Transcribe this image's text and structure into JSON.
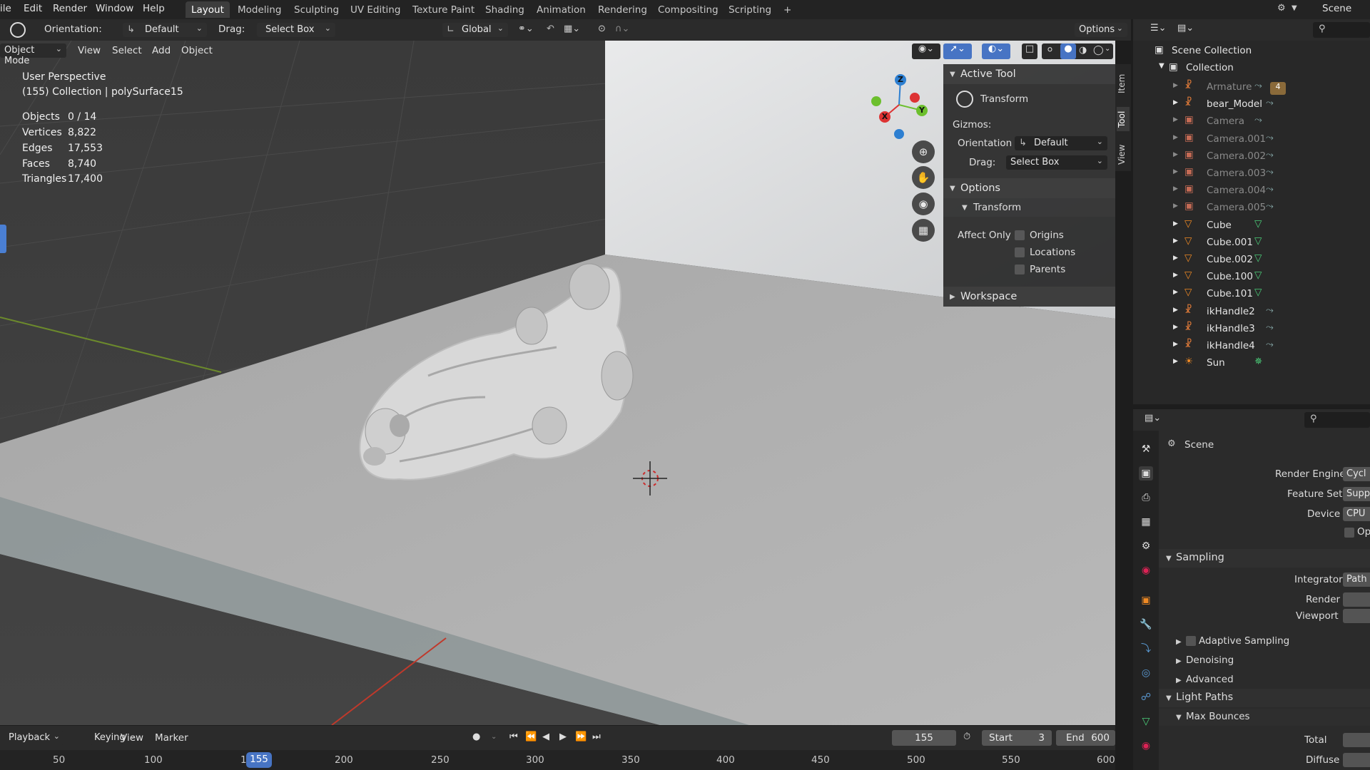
{
  "menubar": {
    "items": [
      "ile",
      "Edit",
      "Render",
      "Window",
      "Help"
    ],
    "tabs": [
      "Layout",
      "Modeling",
      "Sculpting",
      "UV Editing",
      "Texture Paint",
      "Shading",
      "Animation",
      "Rendering",
      "Compositing",
      "Scripting"
    ],
    "add_tab": "+",
    "scene_label": "Scene"
  },
  "tool_header": {
    "orientation_label": "Orientation:",
    "orientation_value": "Default",
    "drag_label": "Drag:",
    "drag_value": "Select Box",
    "transform_orientation": "Global",
    "options_label": "Options"
  },
  "viewport_header": {
    "mode": "Object Mode",
    "menus": [
      "View",
      "Select",
      "Add",
      "Object"
    ]
  },
  "overlay": {
    "perspective": "User Perspective",
    "context": "(155) Collection | polySurface15",
    "stats": [
      {
        "label": "Objects",
        "value": "0 / 14"
      },
      {
        "label": "Vertices",
        "value": "8,822"
      },
      {
        "label": "Edges",
        "value": "17,553"
      },
      {
        "label": "Faces",
        "value": "8,740"
      },
      {
        "label": "Triangles",
        "value": "17,400"
      }
    ]
  },
  "gizmo": {
    "x": "X",
    "y": "Y",
    "z": "Z"
  },
  "npanel": {
    "active_tool_title": "Active Tool",
    "tool_name": "Transform",
    "gizmos_label": "Gizmos:",
    "orientation_label": "Orientation",
    "orientation_value": "Default",
    "drag_label": "Drag:",
    "drag_value": "Select Box",
    "options_title": "Options",
    "transform_sub": "Transform",
    "affect_only_label": "Affect Only",
    "affect_items": [
      "Origins",
      "Locations",
      "Parents"
    ],
    "workspace_title": "Workspace",
    "side_tabs": [
      "Item",
      "Tool",
      "View"
    ]
  },
  "outliner": {
    "root": "Scene Collection",
    "collection": "Collection",
    "items": [
      {
        "name": "Armature",
        "dim": true,
        "color": "#e07b39"
      },
      {
        "name": "bear_Model",
        "dim": false,
        "color": "#e07b39"
      },
      {
        "name": "Camera",
        "dim": true,
        "color": "#c56b55"
      },
      {
        "name": "Camera.001",
        "dim": true,
        "color": "#c56b55"
      },
      {
        "name": "Camera.002",
        "dim": true,
        "color": "#c56b55"
      },
      {
        "name": "Camera.003",
        "dim": true,
        "color": "#c56b55"
      },
      {
        "name": "Camera.004",
        "dim": true,
        "color": "#c56b55"
      },
      {
        "name": "Camera.005",
        "dim": true,
        "color": "#c56b55"
      },
      {
        "name": "Cube",
        "dim": false,
        "color": "#f08a24"
      },
      {
        "name": "Cube.001",
        "dim": false,
        "color": "#f08a24"
      },
      {
        "name": "Cube.002",
        "dim": false,
        "color": "#f08a24"
      },
      {
        "name": "Cube.100",
        "dim": false,
        "color": "#f08a24"
      },
      {
        "name": "Cube.101",
        "dim": false,
        "color": "#f08a24"
      },
      {
        "name": "ikHandle2",
        "dim": false,
        "color": "#e07b39"
      },
      {
        "name": "ikHandle3",
        "dim": false,
        "color": "#e07b39"
      },
      {
        "name": "ikHandle4",
        "dim": false,
        "color": "#e07b39"
      },
      {
        "name": "Sun",
        "dim": false,
        "color": "#f08a24"
      }
    ],
    "armature_badge": "4"
  },
  "properties": {
    "context": "Scene",
    "rows": [
      {
        "label": "Render Engine",
        "value": "Cycl"
      },
      {
        "label": "Feature Set",
        "value": "Supp"
      },
      {
        "label": "Device",
        "value": "CPU"
      }
    ],
    "op_label": "Op",
    "sampling": "Sampling",
    "integrator_label": "Integrator",
    "integrator_value": "Path",
    "render_label": "Render",
    "viewport_label": "Viewport",
    "adaptive": "Adaptive Sampling",
    "denoising": "Denoising",
    "advanced": "Advanced",
    "light_paths": "Light Paths",
    "max_bounces": "Max Bounces",
    "total_label": "Total",
    "diffuse_label": "Diffuse"
  },
  "timeline": {
    "menus": [
      "Playback",
      "Keying",
      "View",
      "Marker"
    ],
    "current_frame": "155",
    "start_label": "Start",
    "start_value": "3",
    "end_label": "End",
    "end_value": "600",
    "ruler": [
      "50",
      "100",
      "1",
      "200",
      "250",
      "300",
      "350",
      "400",
      "450",
      "500",
      "550",
      "600"
    ],
    "playhead": "155"
  }
}
